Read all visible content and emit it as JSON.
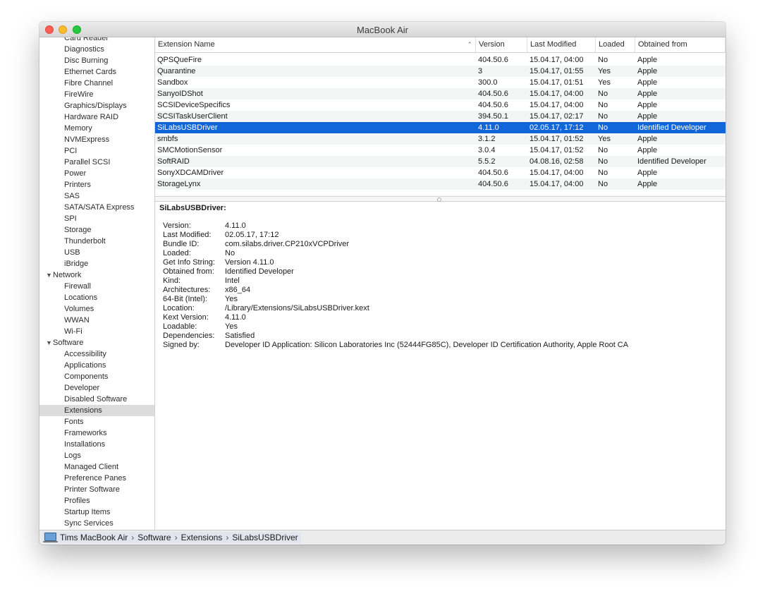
{
  "window": {
    "title": "MacBook Air"
  },
  "sidebar": {
    "items": [
      {
        "label": "Card Reader",
        "kind": "child"
      },
      {
        "label": "Diagnostics",
        "kind": "child"
      },
      {
        "label": "Disc Burning",
        "kind": "child"
      },
      {
        "label": "Ethernet Cards",
        "kind": "child"
      },
      {
        "label": "Fibre Channel",
        "kind": "child"
      },
      {
        "label": "FireWire",
        "kind": "child"
      },
      {
        "label": "Graphics/Displays",
        "kind": "child"
      },
      {
        "label": "Hardware RAID",
        "kind": "child"
      },
      {
        "label": "Memory",
        "kind": "child"
      },
      {
        "label": "NVMExpress",
        "kind": "child"
      },
      {
        "label": "PCI",
        "kind": "child"
      },
      {
        "label": "Parallel SCSI",
        "kind": "child"
      },
      {
        "label": "Power",
        "kind": "child"
      },
      {
        "label": "Printers",
        "kind": "child"
      },
      {
        "label": "SAS",
        "kind": "child"
      },
      {
        "label": "SATA/SATA Express",
        "kind": "child"
      },
      {
        "label": "SPI",
        "kind": "child"
      },
      {
        "label": "Storage",
        "kind": "child"
      },
      {
        "label": "Thunderbolt",
        "kind": "child"
      },
      {
        "label": "USB",
        "kind": "child"
      },
      {
        "label": "iBridge",
        "kind": "child"
      },
      {
        "label": "Network",
        "kind": "group"
      },
      {
        "label": "Firewall",
        "kind": "child"
      },
      {
        "label": "Locations",
        "kind": "child"
      },
      {
        "label": "Volumes",
        "kind": "child"
      },
      {
        "label": "WWAN",
        "kind": "child"
      },
      {
        "label": "Wi-Fi",
        "kind": "child"
      },
      {
        "label": "Software",
        "kind": "group"
      },
      {
        "label": "Accessibility",
        "kind": "child"
      },
      {
        "label": "Applications",
        "kind": "child"
      },
      {
        "label": "Components",
        "kind": "child"
      },
      {
        "label": "Developer",
        "kind": "child"
      },
      {
        "label": "Disabled Software",
        "kind": "child"
      },
      {
        "label": "Extensions",
        "kind": "child",
        "selected": true
      },
      {
        "label": "Fonts",
        "kind": "child"
      },
      {
        "label": "Frameworks",
        "kind": "child"
      },
      {
        "label": "Installations",
        "kind": "child"
      },
      {
        "label": "Logs",
        "kind": "child"
      },
      {
        "label": "Managed Client",
        "kind": "child"
      },
      {
        "label": "Preference Panes",
        "kind": "child"
      },
      {
        "label": "Printer Software",
        "kind": "child"
      },
      {
        "label": "Profiles",
        "kind": "child"
      },
      {
        "label": "Startup Items",
        "kind": "child"
      },
      {
        "label": "Sync Services",
        "kind": "child"
      }
    ]
  },
  "table": {
    "columns": [
      "Extension Name",
      "Version",
      "Last Modified",
      "Loaded",
      "Obtained from"
    ],
    "sort_column": "Extension Name",
    "rows": [
      [
        "QPSQueFire",
        "404.50.6",
        "15.04.17, 04:00",
        "No",
        "Apple"
      ],
      [
        "Quarantine",
        "3",
        "15.04.17, 01:55",
        "Yes",
        "Apple"
      ],
      [
        "Sandbox",
        "300.0",
        "15.04.17, 01:51",
        "Yes",
        "Apple"
      ],
      [
        "SanyoIDShot",
        "404.50.6",
        "15.04.17, 04:00",
        "No",
        "Apple"
      ],
      [
        "SCSIDeviceSpecifics",
        "404.50.6",
        "15.04.17, 04:00",
        "No",
        "Apple"
      ],
      [
        "SCSITaskUserClient",
        "394.50.1",
        "15.04.17, 02:17",
        "No",
        "Apple"
      ],
      [
        "SiLabsUSBDriver",
        "4.11.0",
        "02.05.17, 17:12",
        "No",
        "Identified Developer"
      ],
      [
        "smbfs",
        "3.1.2",
        "15.04.17, 01:52",
        "Yes",
        "Apple"
      ],
      [
        "SMCMotionSensor",
        "3.0.4",
        "15.04.17, 01:52",
        "No",
        "Apple"
      ],
      [
        "SoftRAID",
        "5.5.2",
        "04.08.16, 02:58",
        "No",
        "Identified Developer"
      ],
      [
        "SonyXDCAMDriver",
        "404.50.6",
        "15.04.17, 04:00",
        "No",
        "Apple"
      ],
      [
        "StorageLynx",
        "404.50.6",
        "15.04.17, 04:00",
        "No",
        "Apple"
      ]
    ],
    "selected_row": 6
  },
  "detail": {
    "title": "SiLabsUSBDriver:",
    "fields": [
      {
        "label": "Version:",
        "value": "4.11.0"
      },
      {
        "label": "Last Modified:",
        "value": "02.05.17, 17:12"
      },
      {
        "label": "Bundle ID:",
        "value": "com.silabs.driver.CP210xVCPDriver"
      },
      {
        "label": "Loaded:",
        "value": "No"
      },
      {
        "label": "Get Info String:",
        "value": "Version 4.11.0"
      },
      {
        "label": "Obtained from:",
        "value": "Identified Developer"
      },
      {
        "label": "Kind:",
        "value": "Intel"
      },
      {
        "label": "Architectures:",
        "value": "x86_64"
      },
      {
        "label": "64-Bit (Intel):",
        "value": "Yes"
      },
      {
        "label": "Location:",
        "value": "/Library/Extensions/SiLabsUSBDriver.kext"
      },
      {
        "label": "Kext Version:",
        "value": "4.11.0"
      },
      {
        "label": "Loadable:",
        "value": "Yes"
      },
      {
        "label": "Dependencies:",
        "value": "Satisfied"
      },
      {
        "label": "Signed by:",
        "value": "Developer ID Application: Silicon Laboratories Inc (52444FG85C), Developer ID Certification Authority, Apple Root CA"
      }
    ]
  },
  "pathbar": {
    "icon": "laptop-icon",
    "crumbs": [
      "Tims MacBook Air",
      "Software",
      "Extensions",
      "SiLabsUSBDriver"
    ],
    "separator": "›"
  },
  "colors": {
    "selection": "#1167d9",
    "sidebar_selection": "#dcdcdc",
    "row_alt": "#f4f5f5"
  }
}
